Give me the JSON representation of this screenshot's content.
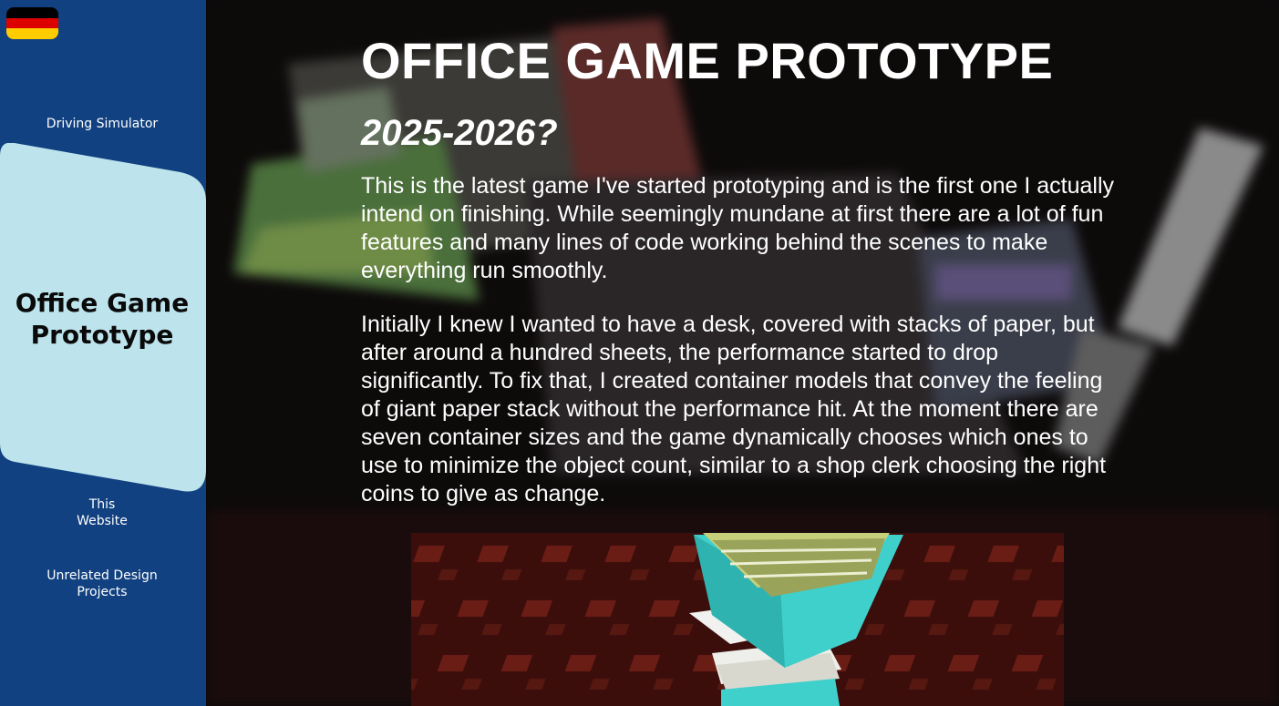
{
  "language_flag": {
    "icon": "german-flag-icon",
    "colors": [
      "#000000",
      "#dd0000",
      "#ffcc00"
    ]
  },
  "sidebar": {
    "items": [
      {
        "label": "Driving Simulator"
      },
      {
        "label": "Office Game Prototype",
        "active": true
      },
      {
        "label": "This\nWebsite"
      },
      {
        "label": "Unrelated Design\nProjects"
      }
    ]
  },
  "main": {
    "title": "OFFICE GAME PROTOTYPE",
    "subtitle": "2025-2026?",
    "paragraphs": [
      "This is the latest game I've started prototyping and is the first one I actually intend on finishing. While seemingly mundane at first there are a lot of fun features and many lines of code working behind the scenes to make everything run smoothly.",
      "Initially I knew I wanted to have a desk, covered with stacks of paper, but after around a hundred sheets, the performance started to drop significantly. To fix that, I created container models that convey the feeling of giant paper stack without the performance hit. At the moment there are seven container sizes and the game dynamically chooses which ones to use to minimize the object count, similar to a shop clerk choosing the right coins to give as change."
    ]
  },
  "colors": {
    "sidebar_bg": "#114180",
    "active_item_bg": "#bde3ec",
    "accent_teal": "#3fd0cc"
  }
}
